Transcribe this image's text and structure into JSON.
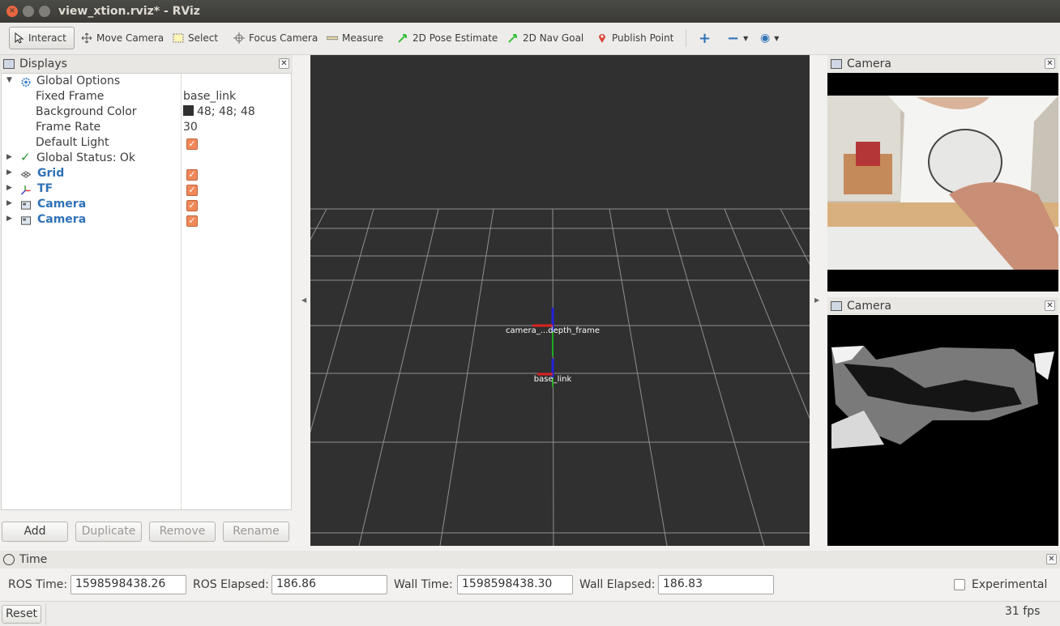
{
  "window": {
    "title": "view_xtion.rviz* - RViz"
  },
  "toolbar": {
    "interact": "Interact",
    "move_camera": "Move Camera",
    "select": "Select",
    "focus_camera": "Focus Camera",
    "measure": "Measure",
    "pose_estimate": "2D Pose Estimate",
    "nav_goal": "2D Nav Goal",
    "publish_point": "Publish Point"
  },
  "displays": {
    "title": "Displays",
    "global_options": "Global Options",
    "fixed_frame_label": "Fixed Frame",
    "fixed_frame_value": "base_link",
    "bg_color_label": "Background Color",
    "bg_color_value": "48; 48; 48",
    "frame_rate_label": "Frame Rate",
    "frame_rate_value": "30",
    "default_light_label": "Default Light",
    "global_status": "Global Status: Ok",
    "items": [
      {
        "label": "Grid"
      },
      {
        "label": "TF"
      },
      {
        "label": "Camera"
      },
      {
        "label": "Camera"
      }
    ],
    "buttons": {
      "add": "Add",
      "duplicate": "Duplicate",
      "remove": "Remove",
      "rename": "Rename"
    }
  },
  "view3d": {
    "background_color": "#303030",
    "frame_labels": {
      "top": "camera_...depth_frame",
      "base": "base_link"
    }
  },
  "cameras": [
    {
      "title": "Camera"
    },
    {
      "title": "Camera"
    }
  ],
  "time": {
    "title": "Time",
    "ros_time_label": "ROS Time:",
    "ros_time": "1598598438.26",
    "ros_elapsed_label": "ROS Elapsed:",
    "ros_elapsed": "186.86",
    "wall_time_label": "Wall Time:",
    "wall_time": "1598598438.30",
    "wall_elapsed_label": "Wall Elapsed:",
    "wall_elapsed": "186.83",
    "experimental": "Experimental"
  },
  "status": {
    "reset": "Reset",
    "fps": "31 fps"
  }
}
